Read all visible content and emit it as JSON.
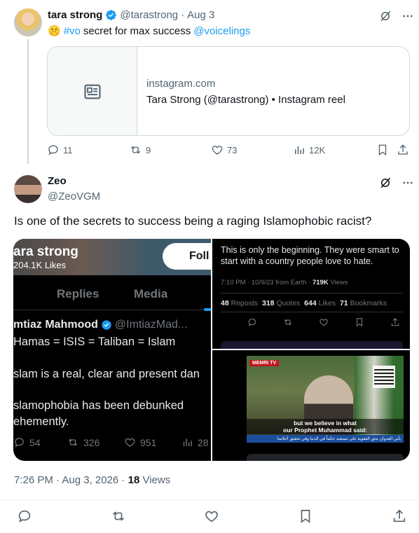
{
  "parent": {
    "display_name": "tara strong",
    "handle": "@tarastrong",
    "dot": "·",
    "date": "Aug 3",
    "emoji": "🤫",
    "hashtag": "#vo",
    "text_middle": "secret for max success",
    "mention": "@voicelings",
    "card": {
      "domain": "instagram.com",
      "title": "Tara Strong (@tarastrong) • Instagram reel"
    },
    "actions": {
      "replies": "11",
      "reposts": "9",
      "likes": "73",
      "views": "12K"
    }
  },
  "reply": {
    "display_name": "Zeo",
    "handle": "@ZeoVGM",
    "text": "Is one of the secrets to success being a raging Islamophobic racist?",
    "timestamp": "7:26 PM · Aug 3, 2026 ·",
    "views_count": "18",
    "views_label": "Views"
  },
  "media": {
    "left": {
      "profile_name": "ara strong",
      "profile_likes": "204.1K Likes",
      "follow_label": "Foll",
      "tab_replies": "Replies",
      "tab_media": "Media",
      "author_name": "mtiaz Mahmood",
      "author_handle": "@ImtiazMad...",
      "lines": [
        "Hamas = ISIS = Taliban = Islam",
        "slam is a real, clear and present dan",
        "slamophobia has been debunked",
        "ehemently."
      ],
      "actions": {
        "replies": "54",
        "reposts": "326",
        "likes": "951",
        "views": "28"
      }
    },
    "top_right": {
      "text": "This is only the beginning. They were smart to start with a country people love to hate.",
      "meta_prefix": "7:10 PM · 10/9/23 from Earth ·",
      "meta_views_count": "719K",
      "meta_views_label": "Views",
      "reposts_count": "48",
      "reposts_label": "Reposts",
      "quotes_count": "318",
      "quotes_label": "Quotes",
      "likes_count": "644",
      "likes_label": "Likes",
      "bookmarks_count": "71",
      "bookmarks_label": "Bookmarks"
    },
    "bottom_right": {
      "logo": "MEMRI TV",
      "subtitle_line1": "but we believe in what",
      "subtitle_line2": "our Prophet Muhammad said:",
      "ticker": "يأتي العدوان يحق العقوبة على تستعيد حكماً في الدنيا وفي تحقيق أحلامنا"
    }
  },
  "icons": {
    "verified": "verified-badge-icon",
    "grok": "grok-icon",
    "more": "more-icon",
    "article": "article-icon",
    "reply": "reply-icon",
    "repost": "repost-icon",
    "like": "like-icon",
    "views": "views-icon",
    "bookmark": "bookmark-icon",
    "share": "share-icon"
  },
  "colors": {
    "accent": "#1d9bf0",
    "text": "#0f1419",
    "muted": "#536471",
    "border": "#cfd9de"
  }
}
